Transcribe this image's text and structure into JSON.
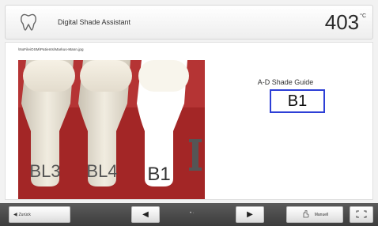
{
  "header": {
    "title": "Digital Shade Assistant",
    "temperature": "403",
    "temperature_unit": "°C",
    "icon": "tooth-icon"
  },
  "content": {
    "file_path": "\\NoFileiOSM\\Patients\\Markus-Mann.jpg",
    "photo": {
      "tabs": [
        "BL3",
        "BL4",
        "B1"
      ],
      "selected_tab": "B1",
      "tab_colors": {
        "BL3": "#d6d0c4",
        "BL4": "#ddd8cc",
        "B1": "#ffffff"
      },
      "background_color": "#a32626"
    },
    "shade_guide": {
      "title": "A-D Shade Guide",
      "value": "B1",
      "highlight_color": "#2d3fd6"
    }
  },
  "bottom_bar": {
    "back_label": "Zurück",
    "back_icon": "chevron-left-icon",
    "prev_icon": "arrow-left-icon",
    "page_indicator": "• ·",
    "next_icon": "arrow-right-icon",
    "manual_label": "Manuell",
    "manual_icon": "hand-pointer-icon",
    "fullscreen_icon": "fullscreen-icon"
  }
}
